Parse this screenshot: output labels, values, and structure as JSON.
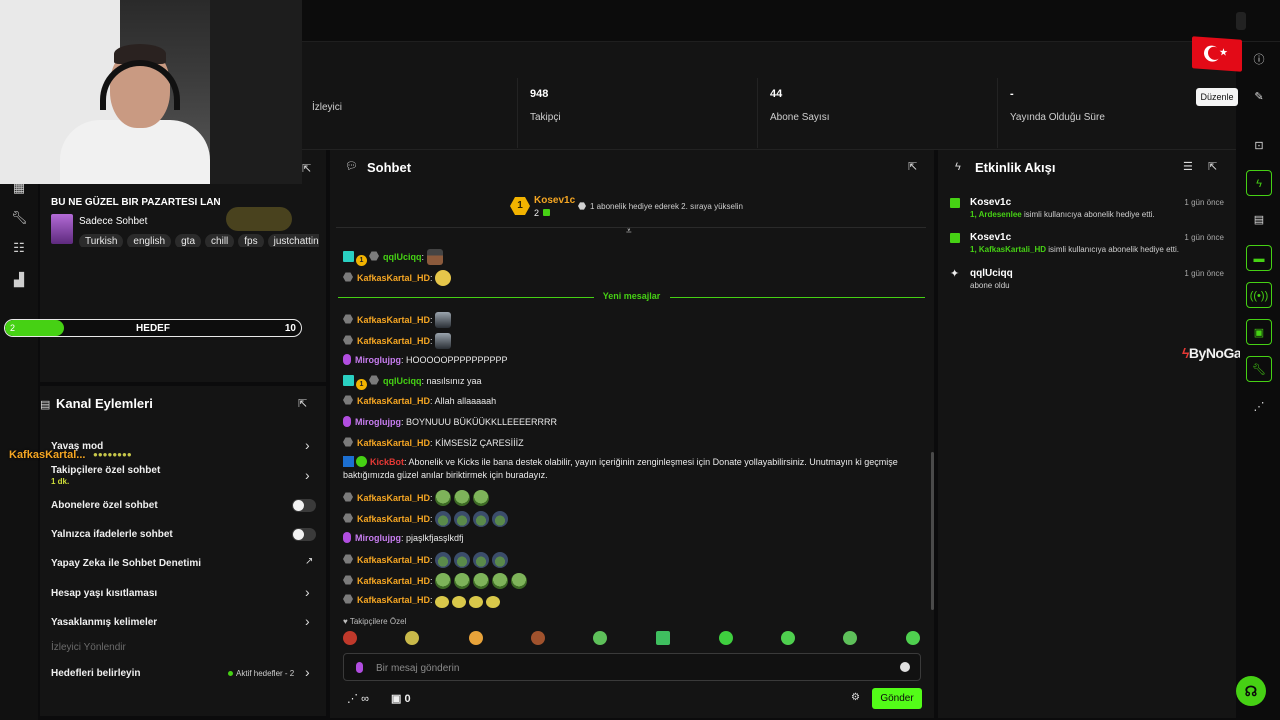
{
  "stats": [
    {
      "value": "",
      "label": "İzleyici"
    },
    {
      "value": "948",
      "label": "Takipçi"
    },
    {
      "value": "44",
      "label": "Abone Sayısı"
    },
    {
      "value": "-",
      "label": "Yayında Olduğu Süre"
    }
  ],
  "stream": {
    "title": "BU NE GÜZEL BIR PAZARTESI LAN",
    "category": "Sadece Sohbet",
    "tags": [
      "Turkish",
      "english",
      "gta",
      "chill",
      "fps",
      "justchatting"
    ]
  },
  "goal": {
    "current": "2",
    "label": "HEDEF",
    "target": "10",
    "progress": 0.2
  },
  "channel_actions": {
    "title": "Kanal Eylemleri",
    "items": [
      {
        "label": "Yavaş mod",
        "type": "chevron"
      },
      {
        "label": "Takipçilere özel sohbet",
        "sub": "1 dk.",
        "type": "chevron"
      },
      {
        "label": "Abonelere özel sohbet",
        "type": "toggle"
      },
      {
        "label": "Yalnızca ifadelerle sohbet",
        "type": "toggle"
      },
      {
        "label": "Yapay Zeka ile Sohbet Denetimi",
        "type": "external"
      },
      {
        "label": "Hesap yaşı kısıtlaması",
        "type": "chevron"
      },
      {
        "label": "Yasaklanmış kelimeler",
        "type": "chevron"
      }
    ],
    "section_label": "İzleyici Yönlendir",
    "goals_label": "Hedefleri belirleyin",
    "active_goals": "Aktif hedefler - 2"
  },
  "overlay": {
    "username": "KafkasKartal..."
  },
  "chat": {
    "title": "Sohbet",
    "pinned": {
      "rank": "1",
      "user": "Kosev1c",
      "count": "2",
      "text": "1 abonelik hediye ederek 2. sıraya yükselin"
    },
    "new_messages": "Yeni mesajlar",
    "messages": [
      {
        "user": "qqlUciqq",
        "text": ""
      },
      {
        "user": "KafkasKartal_HD",
        "text": ""
      },
      {
        "user": "KafkasKartal_HD",
        "text": ""
      },
      {
        "user": "KafkasKartal_HD",
        "text": ""
      },
      {
        "user": "Miroglujpg",
        "text": "HOOOOOPPPPPPPPPP"
      },
      {
        "user": "qqlUciqq",
        "text": "nasılsınız yaa"
      },
      {
        "user": "KafkasKartal_HD",
        "text": "Allah allaaaaah"
      },
      {
        "user": "Miroglujpg",
        "text": "BOYNUUU BÜKÜÜKKLLEEEERRRR"
      },
      {
        "user": "KafkasKartal_HD",
        "text": "KİMSESİZ ÇARESİİİZ"
      },
      {
        "user": "KickBot",
        "text": "Abonelik ve Kicks ile bana destek olabilir, yayın içeriğinin zenginleşmesi için Donate yollayabilirsiniz. Unutmayın ki geçmişe baktığımızda güzel anılar biriktirmek için buradayız."
      },
      {
        "user": "KafkasKartal_HD",
        "text": ""
      },
      {
        "user": "KafkasKartal_HD",
        "text": ""
      },
      {
        "user": "Miroglujpg",
        "text": "pjaşlkfjasşlkdfj"
      },
      {
        "user": "KafkasKartal_HD",
        "text": ""
      },
      {
        "user": "KafkasKartal_HD",
        "text": ""
      },
      {
        "user": "KafkasKartal_HD",
        "text": ""
      }
    ],
    "followers_only": "Takipçilere Özel",
    "input_placeholder": "Bir mesaj gönderin",
    "points": "∞",
    "gifts": "0",
    "send_label": "Gönder"
  },
  "activity": {
    "title": "Etkinlik Akışı",
    "items": [
      {
        "user": "Kosev1c",
        "highlight": "1, Ardesenlee",
        "text": " isimli kullanıcıya abonelik hediye etti.",
        "time": "1 gün önce"
      },
      {
        "user": "Kosev1c",
        "highlight": "1, KafkasKartali_HD",
        "text": " isimli kullanıcıya abonelik hediye etti.",
        "time": "1 gün önce"
      },
      {
        "user": "qqlUciqq",
        "highlight": "",
        "text": "abone oldu",
        "time": "1 gün önce"
      }
    ]
  },
  "tooltip": "Düzenle",
  "watermark": "ByNoGame",
  "colors": {
    "accent": "#53fc18",
    "panel": "#141414",
    "bg": "#0b0b0c",
    "username_orange": "#f5a623",
    "username_green": "#46d114",
    "username_purple": "#c77df0"
  }
}
